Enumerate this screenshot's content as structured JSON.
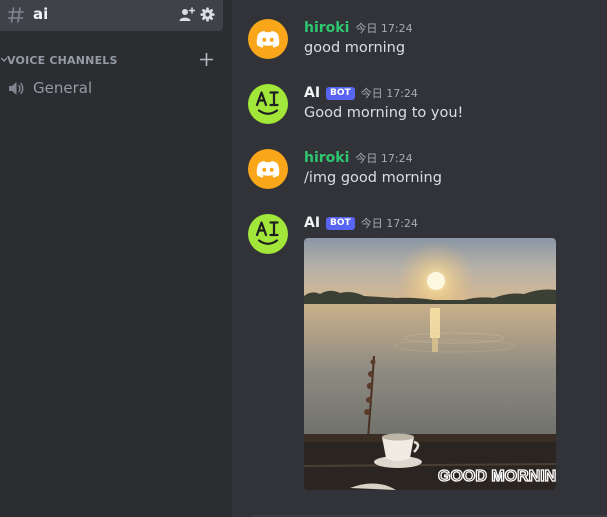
{
  "sidebar": {
    "active_channel": {
      "name": "ai",
      "icon": "hash-icon"
    },
    "channel_actions": [
      "invite-icon",
      "gear-icon"
    ],
    "category": {
      "label": "VOICE CHANNELS",
      "add_icon": "plus-icon"
    },
    "voice_channels": [
      {
        "name": "General",
        "icon": "speaker-icon"
      }
    ]
  },
  "messages": [
    {
      "author": "hiroki",
      "author_color": "#2dc770",
      "bot": false,
      "badge": "",
      "timestamp": "今日 17:24",
      "text": "good morning",
      "avatar": "discord-logo"
    },
    {
      "author": "AI",
      "author_color": "#f2f3f5",
      "bot": true,
      "badge": "BOT",
      "timestamp": "今日 17:24",
      "text": "Good morning to you!",
      "avatar": "ai-smiley"
    },
    {
      "author": "hiroki",
      "author_color": "#2dc770",
      "bot": false,
      "badge": "",
      "timestamp": "今日 17:24",
      "text": "/img good morning",
      "avatar": "discord-logo"
    },
    {
      "author": "AI",
      "author_color": "#f2f3f5",
      "bot": true,
      "badge": "BOT",
      "timestamp": "今日 17:24",
      "text": "",
      "avatar": "ai-smiley",
      "attachment": {
        "kind": "image",
        "scene": "sunrise over lake with coffee cup",
        "caption": "GOOD MORNING"
      }
    }
  ],
  "colors": {
    "sidebar_bg": "#2b2d31",
    "chat_bg": "#313338",
    "active_channel_bg": "#404249",
    "username_green": "#2dc770",
    "bot_badge": "#5865f2",
    "discord_avatar": "#faa61a",
    "ai_avatar": "#a3e63a"
  }
}
